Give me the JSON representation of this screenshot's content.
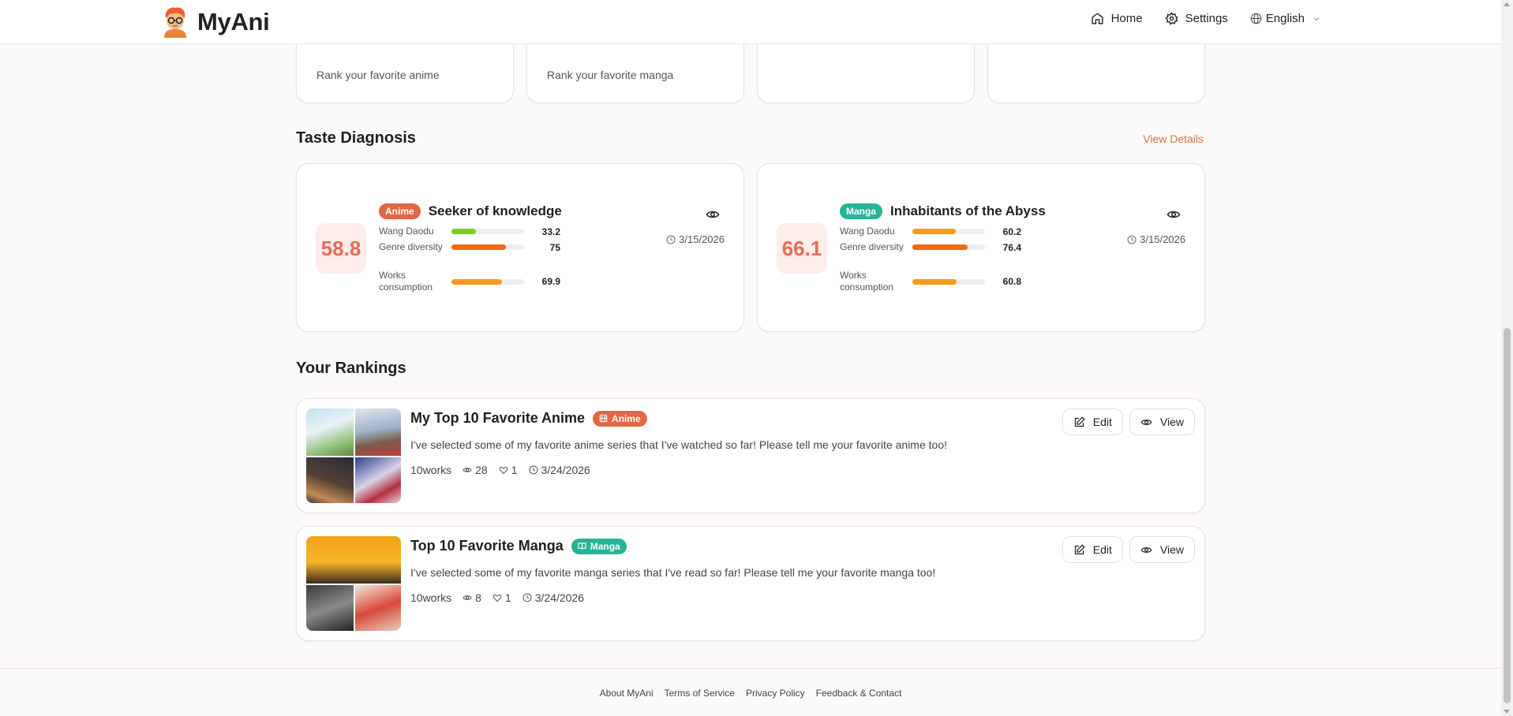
{
  "header": {
    "brand": "MyAni",
    "nav": {
      "home": "Home",
      "settings": "Settings",
      "language": "English"
    }
  },
  "top_cards": [
    {
      "subtitle": "Rank your favorite anime"
    },
    {
      "subtitle": "Rank your favorite manga"
    },
    {
      "subtitle": ""
    },
    {
      "subtitle": ""
    }
  ],
  "taste": {
    "title": "Taste Diagnosis",
    "view_details": "View Details",
    "cards": [
      {
        "score": "58.8",
        "badge": "Anime",
        "title": "Seeker of knowledge",
        "date": "3/15/2026",
        "metrics": [
          {
            "label": "Wang Daodu",
            "value": "33.2",
            "fraction": 0.332,
            "color": "#7ccd1e"
          },
          {
            "label": "Genre diversity",
            "value": "75",
            "fraction": 0.75,
            "color": "#f26a0f"
          },
          {
            "label": "Works consumption",
            "value": "69.9",
            "fraction": 0.699,
            "color": "#fb9a14"
          }
        ]
      },
      {
        "score": "66.1",
        "badge": "Manga",
        "title": "Inhabitants of the Abyss",
        "date": "3/15/2026",
        "metrics": [
          {
            "label": "Wang Daodu",
            "value": "60.2",
            "fraction": 0.602,
            "color": "#fb9a14"
          },
          {
            "label": "Genre diversity",
            "value": "76.4",
            "fraction": 0.764,
            "color": "#f26a0f"
          },
          {
            "label": "Works consumption",
            "value": "60.8",
            "fraction": 0.608,
            "color": "#fb9a14"
          }
        ]
      }
    ]
  },
  "rankings": {
    "title": "Your Rankings",
    "items": [
      {
        "title": "My Top 10 Favorite Anime",
        "badge": "Anime",
        "description": "I've selected some of my favorite anime series that I've watched so far! Please tell me your favorite anime too!",
        "works": "10works",
        "views": "28",
        "likes": "1",
        "date": "3/24/2026",
        "edit": "Edit",
        "view": "View"
      },
      {
        "title": "Top 10 Favorite Manga",
        "badge": "Manga",
        "description": "I've selected some of my favorite manga series that I've read so far! Please tell me your favorite manga too!",
        "works": "10works",
        "views": "8",
        "likes": "1",
        "date": "3/24/2026",
        "edit": "Edit",
        "view": "View"
      }
    ]
  },
  "footer": {
    "links": [
      "About MyAni",
      "Terms of Service",
      "Privacy Policy",
      "Feedback & Contact"
    ]
  },
  "colors": {
    "accent": "#d9704d",
    "anime_badge": "#e06845",
    "manga_badge": "#26b497",
    "score_text": "#e36d5a",
    "score_bg": "#fdecea"
  }
}
